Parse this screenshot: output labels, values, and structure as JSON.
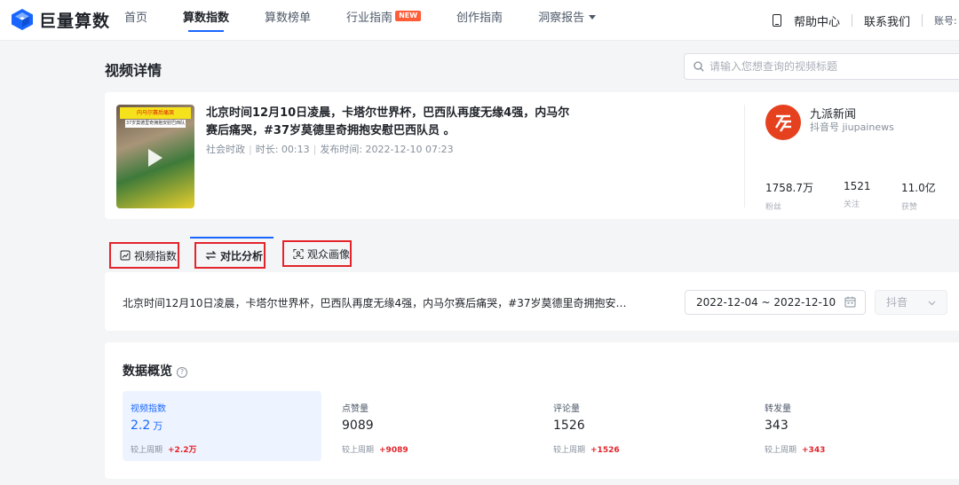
{
  "header": {
    "logo_text": "巨量算数",
    "nav": [
      {
        "label": "首页",
        "active": false
      },
      {
        "label": "算数指数",
        "active": true
      },
      {
        "label": "算数榜单",
        "active": false
      },
      {
        "label": "行业指南",
        "active": false,
        "badge": "NEW"
      },
      {
        "label": "创作指南",
        "active": false
      },
      {
        "label": "洞察报告",
        "active": false
      }
    ],
    "help_label": "帮助中心",
    "contact_label": "联系我们",
    "account_label": "账号:"
  },
  "page": {
    "title": "视频详情",
    "search_placeholder": "请输入您想查询的视频标题"
  },
  "video": {
    "thumb_tag": "内马尔赛后痛哭",
    "thumb_tag2": "37岁莫德里奇拥抱安慰巴西队员",
    "title": "北京时间12月10日凌晨，卡塔尔世界杯，巴西队再度无缘4强，内马尔赛后痛哭，#37岁莫德里奇拥抱安慰巴西队员 。",
    "category": "社会时政",
    "duration": "时长: 00:13",
    "publish_time": "发布时间: 2022-12-10 07:23"
  },
  "author": {
    "name": "九派新闻",
    "handle": "抖音号 jiupainews",
    "stats": [
      {
        "value": "1758.7万",
        "label": "粉丝"
      },
      {
        "value": "1521",
        "label": "关注"
      },
      {
        "value": "11.0亿",
        "label": "获赞"
      }
    ]
  },
  "tabs": [
    {
      "label": "视频指数",
      "icon": "trend-chart-icon",
      "active": false
    },
    {
      "label": "对比分析",
      "icon": "compare-arrows-icon",
      "active": true
    },
    {
      "label": "观众画像",
      "icon": "audience-scan-icon",
      "active": false
    }
  ],
  "filter": {
    "video_title": "北京时间12月10日凌晨，卡塔尔世界杯，巴西队再度无缘4强，内马尔赛后痛哭，#37岁莫德里奇拥抱安慰巴西...",
    "date_range": "2022-12-04 ~ 2022-12-10",
    "platform": "抖音"
  },
  "overview": {
    "title": "数据概览",
    "metrics": [
      {
        "label": "视频指数",
        "value": "2.2",
        "unit": "万",
        "compare_label": "较上周期",
        "delta": "+2.2万",
        "active": true
      },
      {
        "label": "点赞量",
        "value": "9089",
        "unit": "",
        "compare_label": "较上周期",
        "delta": "+9089",
        "active": false
      },
      {
        "label": "评论量",
        "value": "1526",
        "unit": "",
        "compare_label": "较上周期",
        "delta": "+1526",
        "active": false
      },
      {
        "label": "转发量",
        "value": "343",
        "unit": "",
        "compare_label": "较上周期",
        "delta": "+343",
        "active": false
      }
    ]
  },
  "colors": {
    "accent": "#1966ff",
    "highlight_box": "#e3242b",
    "new_badge": "#ff5c38",
    "avatar_bg": "#e6411f"
  }
}
